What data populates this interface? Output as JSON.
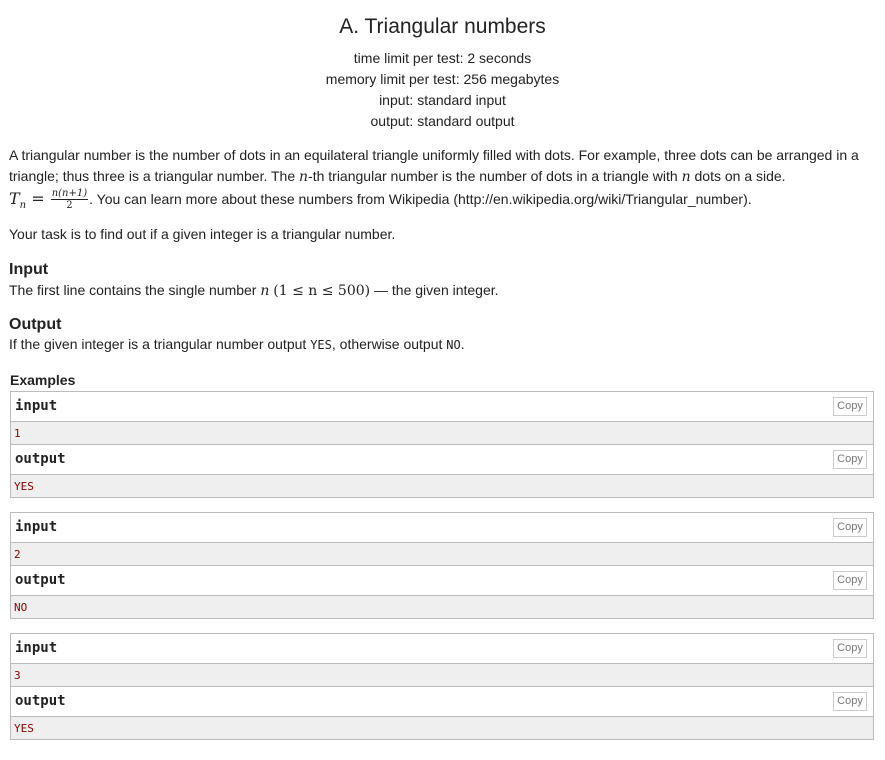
{
  "problem": {
    "title": "A. Triangular numbers",
    "time_limit": "time limit per test: 2 seconds",
    "memory_limit": "memory limit per test: 256 megabytes",
    "input_file": "input: standard input",
    "output_file": "output: standard output"
  },
  "statement": {
    "line1": "A triangular number is the number of dots in an equilateral triangle uniformly filled with dots. For example, three dots can be arranged in a",
    "line2_a": "triangle; thus three is a triangular number. The ",
    "var_n": "n",
    "line2_b": "-th triangular number is the number of dots in a triangle with ",
    "line2_c": " dots on a side.",
    "formula_lhs": "T",
    "formula_sub": "n",
    "formula_eq": " = ",
    "formula_num": "n(n+1)",
    "formula_den": "2",
    "line3": ". You can learn more about these numbers from Wikipedia (http://en.wikipedia.org/wiki/Triangular_number).",
    "task": "Your task is to find out if a given integer is a triangular number."
  },
  "input_spec": {
    "heading": "Input",
    "text_a": "The first line contains the single number ",
    "constraint": "(1 ≤ n ≤ 500)",
    "text_b": " — the given integer."
  },
  "output_spec": {
    "heading": "Output",
    "text_a": "If the given integer is a triangular number output ",
    "yes": "YES",
    "text_b": ", otherwise output ",
    "no": "NO",
    "text_c": "."
  },
  "examples": {
    "heading": "Examples",
    "input_label": "input",
    "output_label": "output",
    "copy_label": "Copy",
    "items": [
      {
        "input": "1",
        "output": "YES"
      },
      {
        "input": "2",
        "output": "NO"
      },
      {
        "input": "3",
        "output": "YES"
      }
    ]
  }
}
